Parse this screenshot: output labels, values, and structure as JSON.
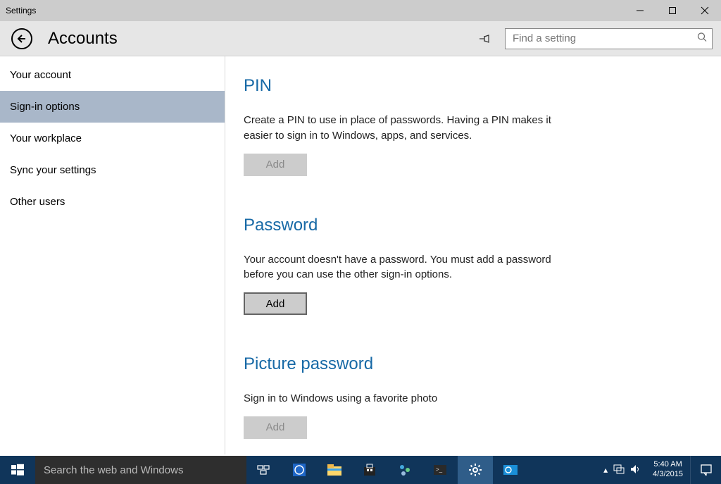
{
  "window": {
    "title": "Settings",
    "header": "Accounts",
    "search_placeholder": "Find a setting"
  },
  "sidebar": {
    "items": [
      {
        "label": "Your account",
        "selected": false
      },
      {
        "label": "Sign-in options",
        "selected": true
      },
      {
        "label": "Your workplace",
        "selected": false
      },
      {
        "label": "Sync your settings",
        "selected": false
      },
      {
        "label": "Other users",
        "selected": false
      }
    ]
  },
  "sections": {
    "pin": {
      "title": "PIN",
      "desc": "Create a PIN to use in place of passwords. Having a PIN makes it easier to sign in to Windows, apps, and services.",
      "button": "Add"
    },
    "password": {
      "title": "Password",
      "desc": "Your account doesn't have a password. You must add a password before you can use the other sign-in options.",
      "button": "Add"
    },
    "picture": {
      "title": "Picture password",
      "desc": "Sign in to Windows using a favorite photo",
      "button": "Add"
    }
  },
  "taskbar": {
    "search_placeholder": "Search the web and Windows",
    "clock_time": "5:40 AM",
    "clock_date": "4/3/2015"
  }
}
